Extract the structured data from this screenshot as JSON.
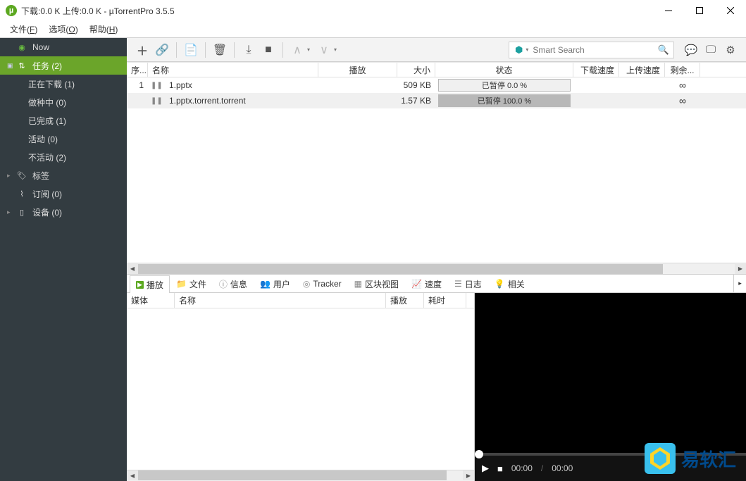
{
  "titlebar": {
    "text": "下载:0.0 K 上传:0.0 K - µTorrentPro 3.5.5"
  },
  "menubar": {
    "file": "文件",
    "file_key": "F",
    "options": "选项",
    "options_key": "O",
    "help": "帮助",
    "help_key": "H"
  },
  "sidebar": {
    "now": "Now",
    "tasks": "任务 (2)",
    "downloading": "正在下载 (1)",
    "seeding": "做种中 (0)",
    "completed": "已完成 (1)",
    "active": "活动 (0)",
    "inactive": "不活动 (2)",
    "labels": "标签",
    "feeds": "订阅 (0)",
    "devices": "设备 (0)"
  },
  "search": {
    "placeholder": "Smart Search"
  },
  "columns": {
    "index": "序...",
    "name": "名称",
    "play": "播放",
    "size": "大小",
    "status": "状态",
    "dlspeed": "下载速度",
    "ulspeed": "上传速度",
    "remaining": "剩余..."
  },
  "rows": [
    {
      "idx": "1",
      "name": "1.pptx",
      "size": "509 KB",
      "status": "已暂停 0.0 %",
      "progress": 0,
      "remaining": "∞"
    },
    {
      "idx": "",
      "name": "1.pptx.torrent.torrent",
      "size": "1.57 KB",
      "status": "已暂停 100.0 %",
      "progress": 100,
      "remaining": "∞"
    }
  ],
  "tabs": {
    "play": "播放",
    "files": "文件",
    "info": "信息",
    "peers": "用户",
    "tracker": "Tracker",
    "pieces": "区块视图",
    "speed": "速度",
    "log": "日志",
    "related": "相关"
  },
  "detail_cols": {
    "media": "媒体",
    "name": "名称",
    "play": "播放",
    "time": "耗时"
  },
  "video": {
    "time_current": "00:00",
    "time_total": "00:00"
  },
  "watermark": {
    "text": "易软汇"
  }
}
